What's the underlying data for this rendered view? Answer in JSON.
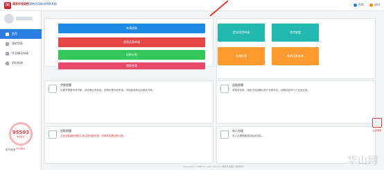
{
  "header": {
    "logo_mark": "国",
    "brand": "国家开发银行",
    "subtitle": "生源地信用助学贷款系统",
    "help_label": "帮助",
    "logout_label": "退出"
  },
  "sidebar": {
    "items": [
      {
        "label": "首页"
      },
      {
        "label": "我的贷款"
      },
      {
        "label": "毕业确认申请"
      },
      {
        "label": "资料修改"
      }
    ],
    "score": {
      "value": "95593",
      "label": "学生积分"
    },
    "score_note": "积分信息",
    "bottom_label": "账号管理"
  },
  "actions": {
    "primary": "申请贷款",
    "secondary": "提前还款申请",
    "tertiary": "还款计划",
    "quaternary": "贷款合同"
  },
  "tiles": [
    {
      "label": "提交续贷申请",
      "color": "teal"
    },
    {
      "label": "续贷查看",
      "color": "teal"
    },
    {
      "label": "在线办理",
      "color": "orange"
    },
    {
      "label": "提前还款查询",
      "color": "orange"
    }
  ],
  "notices": [
    {
      "title": "贷款提醒",
      "text": "如果您需要申请贷款，请查看合同信息，按照步骤完成申请。学校信息核实后确认贷款。"
    },
    {
      "title": "还款提醒",
      "text": "请按时还款，还款日前请确认账户余额充足，逾期将影响个人征信记录。"
    },
    {
      "title": "还款提醒",
      "text": "正在还款期的借款人请注意还款时间，详情请查看还款计划。",
      "red": true
    },
    {
      "title": "本人办理",
      "text": "本人办理需要提供相关材料。"
    }
  ],
  "footer": "Copyright © 2005 All rights reserved 国家开发银行 版权所有",
  "float_panel": {
    "label": "在线客服"
  },
  "watermark": "华山网"
}
